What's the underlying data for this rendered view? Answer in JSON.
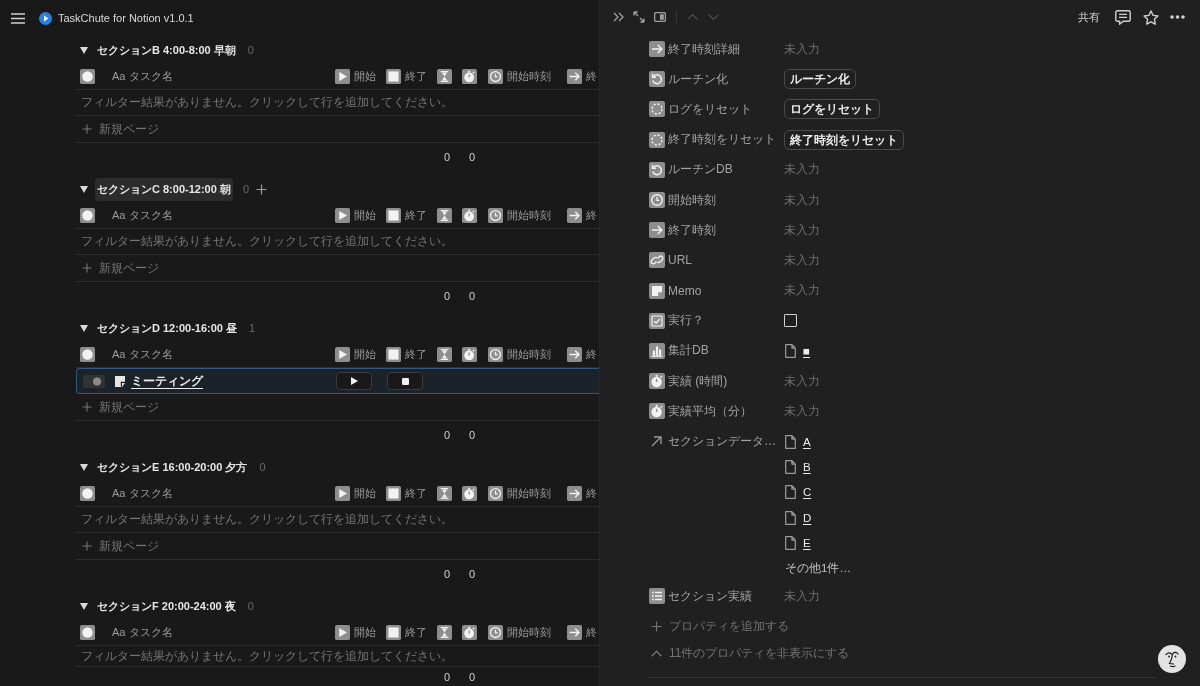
{
  "topbar": {
    "title": "TaskChute for Notion v1.0.1"
  },
  "sections": [
    {
      "title": "セクションB 4:00-8:00 早朝",
      "count": "0",
      "hovered": false,
      "columns": [
        {
          "kind": "status"
        },
        {
          "kind": "title",
          "prefix": "Aa",
          "label": "タスク名"
        },
        {
          "kind": "start",
          "label": "開始"
        },
        {
          "kind": "end",
          "label": "終了"
        },
        {
          "kind": "duration"
        },
        {
          "kind": "elapsed"
        },
        {
          "kind": "start_time",
          "label": "開始時刻"
        },
        {
          "kind": "end_time",
          "label": "終"
        }
      ],
      "empty_message": "フィルター結果がありません。クリックして行を追加してください。",
      "new_page": "新規ページ",
      "summary": [
        "0",
        "0"
      ]
    },
    {
      "title": "セクションC 8:00-12:00 朝",
      "count": "0",
      "hovered": true,
      "columns": [
        {
          "kind": "status"
        },
        {
          "kind": "title",
          "prefix": "Aa",
          "label": "タスク名"
        },
        {
          "kind": "start",
          "label": "開始"
        },
        {
          "kind": "end",
          "label": "終了"
        },
        {
          "kind": "duration"
        },
        {
          "kind": "elapsed"
        },
        {
          "kind": "start_time",
          "label": "開始時刻"
        },
        {
          "kind": "end_time",
          "label": "終"
        }
      ],
      "empty_message": "フィルター結果がありません。クリックして行を追加してください。",
      "new_page": "新規ページ",
      "summary": [
        "0",
        "0"
      ]
    },
    {
      "title": "セクションD 12:00-16:00 昼",
      "count": "1",
      "hovered": false,
      "columns": [
        {
          "kind": "status"
        },
        {
          "kind": "title",
          "prefix": "Aa",
          "label": "タスク名"
        },
        {
          "kind": "start",
          "label": "開始"
        },
        {
          "kind": "end",
          "label": "終了"
        },
        {
          "kind": "duration"
        },
        {
          "kind": "elapsed"
        },
        {
          "kind": "start_time",
          "label": "開始時刻"
        },
        {
          "kind": "end_time",
          "label": "終"
        }
      ],
      "rows": [
        {
          "title": "ミーティング",
          "selected": true
        }
      ],
      "new_page": "新規ページ",
      "summary": [
        "0",
        "0"
      ]
    },
    {
      "title": "セクションE 16:00-20:00 夕方",
      "count": "0",
      "hovered": false,
      "columns": [
        {
          "kind": "status"
        },
        {
          "kind": "title",
          "prefix": "Aa",
          "label": "タスク名"
        },
        {
          "kind": "start",
          "label": "開始"
        },
        {
          "kind": "end",
          "label": "終了"
        },
        {
          "kind": "duration"
        },
        {
          "kind": "elapsed"
        },
        {
          "kind": "start_time",
          "label": "開始時刻"
        },
        {
          "kind": "end_time",
          "label": "終"
        }
      ],
      "empty_message": "フィルター結果がありません。クリックして行を追加してください。",
      "new_page": "新規ページ",
      "summary": [
        "0",
        "0"
      ]
    },
    {
      "title": "セクションF 20:00-24:00 夜",
      "count": "0",
      "hovered": false,
      "columns": [
        {
          "kind": "status"
        },
        {
          "kind": "title",
          "prefix": "Aa",
          "label": "タスク名"
        },
        {
          "kind": "start",
          "label": "開始"
        },
        {
          "kind": "end",
          "label": "終了"
        },
        {
          "kind": "duration"
        },
        {
          "kind": "elapsed"
        },
        {
          "kind": "start_time",
          "label": "開始時刻"
        },
        {
          "kind": "end_time",
          "label": "終"
        }
      ],
      "empty_message": "フィルター結果がありません。クリックして行を追加してください。",
      "summary": [
        "0",
        "0"
      ]
    }
  ],
  "panel": {
    "share": "共有",
    "previous_disabled": true,
    "next_disabled": true,
    "properties": [
      {
        "label": "終了時刻詳細",
        "kind": "empty",
        "value": "未入力"
      },
      {
        "label": "ルーチン化",
        "kind": "button",
        "value": "ルーチン化"
      },
      {
        "label": "ログをリセット",
        "kind": "button",
        "value": "ログをリセット"
      },
      {
        "label": "終了時刻をリセット",
        "kind": "button",
        "value": "終了時刻をリセット"
      },
      {
        "label": "ルーチンDB",
        "kind": "empty",
        "value": "未入力"
      },
      {
        "label": "開始時刻",
        "kind": "empty",
        "value": "未入力"
      },
      {
        "label": "終了時刻",
        "kind": "empty",
        "value": "未入力"
      },
      {
        "label": "URL",
        "kind": "empty",
        "value": "未入力"
      },
      {
        "label": "Memo",
        "kind": "empty",
        "value": "未入力"
      },
      {
        "label": "実行？",
        "kind": "checkbox",
        "checked": false
      },
      {
        "label": "集計DB",
        "kind": "relation",
        "pages": [
          "■"
        ]
      },
      {
        "label": "実績 (時間)",
        "kind": "empty",
        "value": "未入力"
      },
      {
        "label": "実績平均（分）",
        "kind": "empty",
        "value": "未入力"
      },
      {
        "label": "セクションデータ…",
        "kind": "relation",
        "pages": [
          "A",
          "B",
          "C",
          "D",
          "E"
        ],
        "more": "その他1件…"
      },
      {
        "label": "セクション実績",
        "kind": "empty",
        "value": "未入力"
      }
    ],
    "add_property": "プロパティを追加する",
    "hide_properties": "11件のプロパティを非表示にする"
  }
}
